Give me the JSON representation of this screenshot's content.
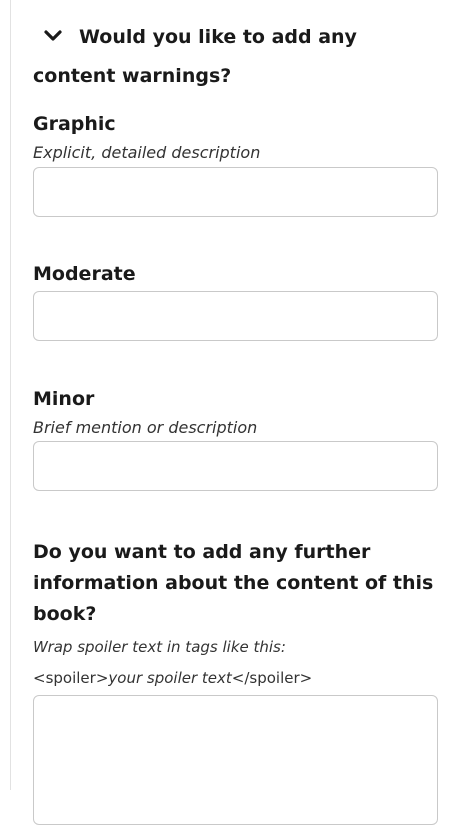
{
  "section": {
    "title": "Would you like to add any content warnings?"
  },
  "graphic": {
    "label": "Graphic",
    "hint": "Explicit, detailed description",
    "value": ""
  },
  "moderate": {
    "label": "Moderate",
    "value": ""
  },
  "minor": {
    "label": "Minor",
    "hint": "Brief mention or description",
    "value": ""
  },
  "further_info": {
    "label": "Do you want to add any further information about the content of this book?",
    "hint": "Wrap spoiler text in tags like this:",
    "example_open_tag": "<spoiler>",
    "example_inner": "your spoiler text",
    "example_close_tag": "</spoiler>",
    "value": ""
  },
  "icons": {
    "collapse": "chevron-down-icon"
  }
}
